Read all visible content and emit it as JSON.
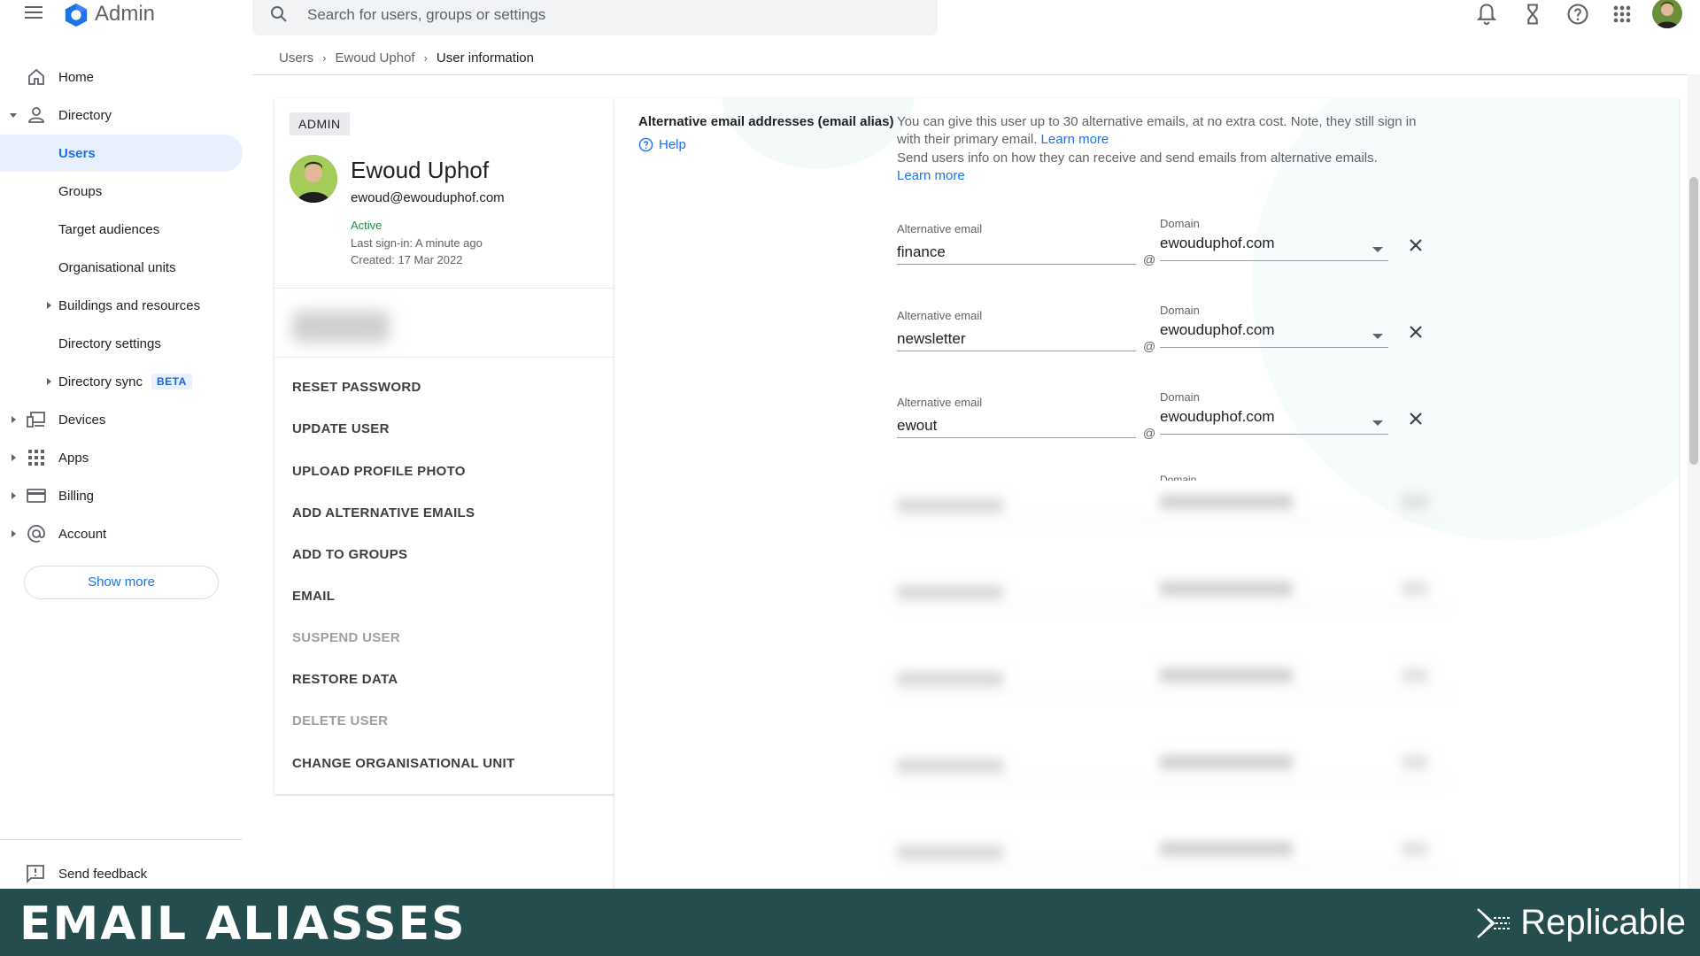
{
  "app": {
    "brand": "Admin"
  },
  "search": {
    "placeholder": "Search for users, groups or settings"
  },
  "breadcrumb": {
    "items": [
      "Users",
      "Ewoud Uphof"
    ],
    "current": "User information"
  },
  "sidebar": {
    "items": [
      {
        "label": "Home",
        "icon": "home-icon"
      },
      {
        "label": "Directory",
        "icon": "person-icon"
      },
      {
        "label": "Users"
      },
      {
        "label": "Groups"
      },
      {
        "label": "Target audiences"
      },
      {
        "label": "Organisational units"
      },
      {
        "label": "Buildings and resources"
      },
      {
        "label": "Directory settings"
      },
      {
        "label": "Directory sync",
        "badge": "BETA"
      },
      {
        "label": "Devices",
        "icon": "devices-icon"
      },
      {
        "label": "Apps",
        "icon": "apps-grid-icon"
      },
      {
        "label": "Billing",
        "icon": "credit-card-icon"
      },
      {
        "label": "Account",
        "icon": "at-sign-icon"
      }
    ],
    "show_more": "Show more",
    "feedback": "Send feedback"
  },
  "user": {
    "role": "ADMIN",
    "name": "Ewoud Uphof",
    "email": "ewoud@ewouduphof.com",
    "status": "Active",
    "last_signin": "Last sign-in: A minute ago",
    "created": "Created: 17 Mar 2022"
  },
  "actions": [
    {
      "label": "RESET PASSWORD",
      "enabled": true
    },
    {
      "label": "UPDATE USER",
      "enabled": true
    },
    {
      "label": "UPLOAD PROFILE PHOTO",
      "enabled": true
    },
    {
      "label": "ADD ALTERNATIVE EMAILS",
      "enabled": true
    },
    {
      "label": "ADD TO GROUPS",
      "enabled": true
    },
    {
      "label": "EMAIL",
      "enabled": true
    },
    {
      "label": "SUSPEND USER",
      "enabled": false
    },
    {
      "label": "RESTORE DATA",
      "enabled": true
    },
    {
      "label": "DELETE USER",
      "enabled": false
    },
    {
      "label": "CHANGE ORGANISATIONAL UNIT",
      "enabled": true
    }
  ],
  "alias_section": {
    "title": "Alternative email addresses (email alias)",
    "help": "Help",
    "desc1": "You can give this user up to 30 alternative emails, at no extra cost. Note, they still sign in with their primary email.",
    "desc1_link": "Learn more",
    "desc2": "Send users info on how they can receive and send emails from alternative emails.",
    "desc2_link": "Learn more",
    "field_label": "Alternative email",
    "domain_label": "Domain",
    "at": "@",
    "aliases": [
      {
        "value": "finance",
        "domain": "ewouduphof.com"
      },
      {
        "value": "newsletter",
        "domain": "ewouduphof.com"
      },
      {
        "value": "ewout",
        "domain": "ewouduphof.com"
      }
    ],
    "partial_domain_label": "Domain"
  },
  "banner": {
    "title": "EMAIL ALIASSES",
    "brand": "Replicable"
  },
  "colors": {
    "accent": "#1a73e8",
    "active": "#1e8e3e",
    "banner": "#264d4d"
  }
}
